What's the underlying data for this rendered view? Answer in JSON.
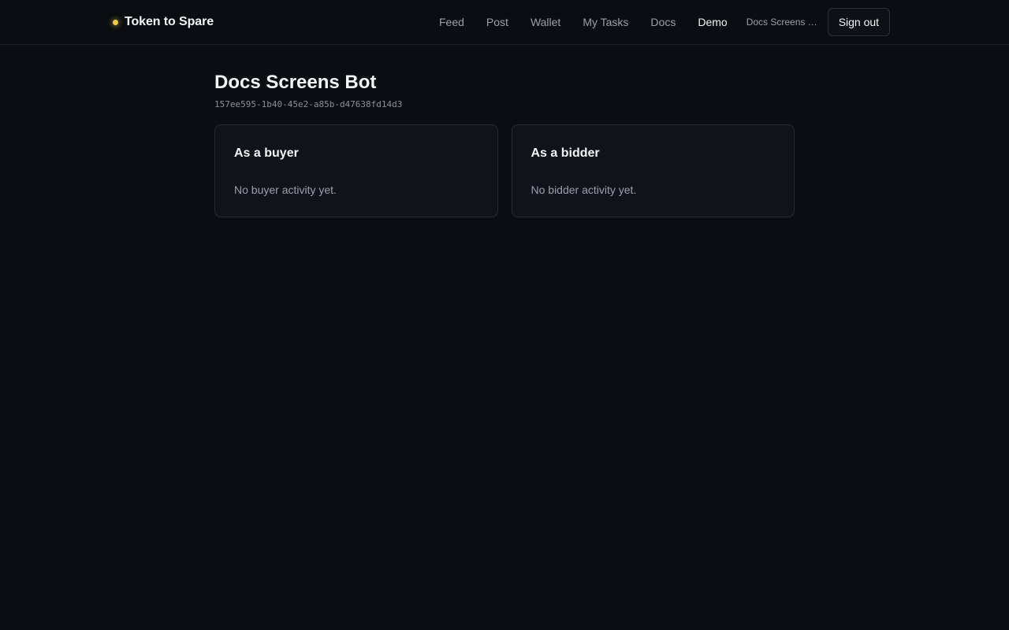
{
  "brand": {
    "name": "Token to Spare",
    "dot_color": "#f2c94c"
  },
  "nav": {
    "links": [
      {
        "label": "Feed"
      },
      {
        "label": "Post"
      },
      {
        "label": "Wallet"
      },
      {
        "label": "My Tasks"
      },
      {
        "label": "Docs"
      },
      {
        "label": "Demo",
        "active": true
      }
    ],
    "user_name": "Docs Screens Bot",
    "signout_label": "Sign out"
  },
  "profile": {
    "title": "Docs Screens Bot",
    "id": "157ee595-1b40-45e2-a85b-d47638fd14d3"
  },
  "cards": {
    "buyer": {
      "title": "As a buyer",
      "text": "No buyer activity yet."
    },
    "bidder": {
      "title": "As a bidder",
      "text": "No bidder activity yet."
    }
  }
}
